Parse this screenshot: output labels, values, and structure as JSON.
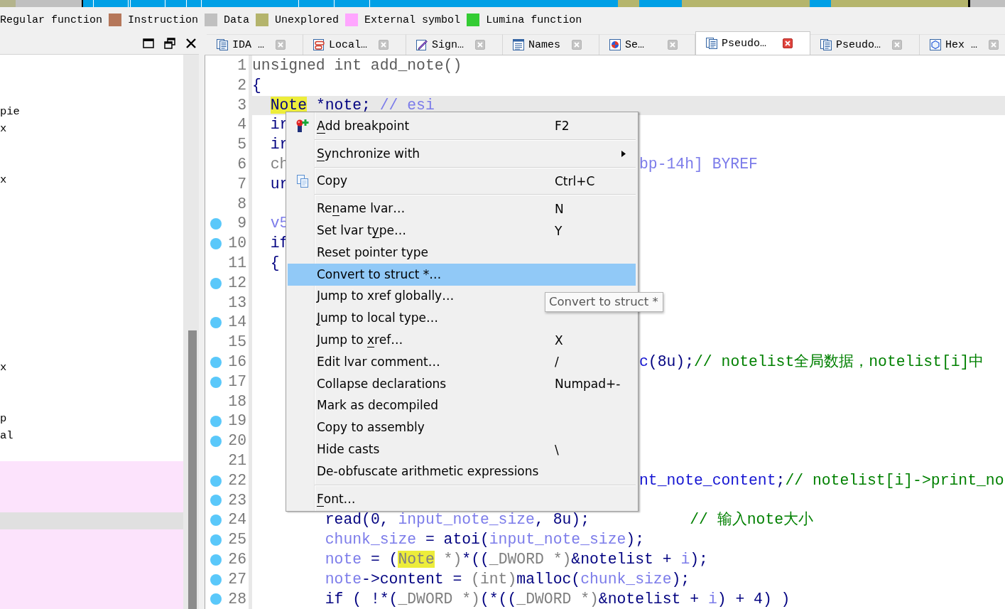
{
  "legend": [
    {
      "label": "Regular function"
    },
    {
      "label": "Instruction",
      "color": "#b5775a"
    },
    {
      "label": "Data",
      "color": "#c0c0c0"
    },
    {
      "label": "Unexplored",
      "color": "#b4b46c"
    },
    {
      "label": "External symbol",
      "color": "#ffa6ff"
    },
    {
      "label": "Lumina function",
      "color": "#33cc33"
    }
  ],
  "left_panel": {
    "rows": [
      {
        "kind": "function",
        "selected": false
      },
      {
        "kind": "function",
        "selected": false
      },
      {
        "kind": "function",
        "selected": false,
        "text": "pie"
      },
      {
        "kind": "function",
        "selected": false,
        "text": "x"
      },
      {
        "kind": "function",
        "selected": false
      },
      {
        "kind": "function",
        "selected": false
      },
      {
        "kind": "function",
        "selected": false,
        "text": "x"
      },
      {
        "kind": "function",
        "selected": false
      },
      {
        "kind": "function",
        "selected": false
      },
      {
        "kind": "function",
        "selected": false
      },
      {
        "kind": "function",
        "selected": false
      },
      {
        "kind": "function",
        "selected": false
      },
      {
        "kind": "function",
        "selected": false
      },
      {
        "kind": "function",
        "selected": false
      },
      {
        "kind": "function",
        "selected": false
      },
      {
        "kind": "function",
        "selected": false
      },
      {
        "kind": "function",
        "selected": false
      },
      {
        "kind": "function",
        "selected": false,
        "text": "x"
      },
      {
        "kind": "function",
        "selected": false
      },
      {
        "kind": "function",
        "selected": false
      },
      {
        "kind": "function",
        "selected": false,
        "text": "p"
      },
      {
        "kind": "function",
        "selected": false,
        "text": "al"
      },
      {
        "kind": "function",
        "selected": false
      },
      {
        "kind": "external",
        "selected": false
      },
      {
        "kind": "external",
        "selected": false
      },
      {
        "kind": "external",
        "selected": false
      },
      {
        "kind": "external",
        "selected": true
      },
      {
        "kind": "external",
        "selected": false
      },
      {
        "kind": "external",
        "selected": false
      },
      {
        "kind": "external",
        "selected": false
      },
      {
        "kind": "external",
        "selected": false
      },
      {
        "kind": "external",
        "selected": false
      }
    ]
  },
  "tabs": [
    {
      "label": "IDA …",
      "selected": false
    },
    {
      "label": "Local…",
      "selected": false
    },
    {
      "label": "Sign…",
      "selected": false
    },
    {
      "label": "Names",
      "selected": false
    },
    {
      "label": "Se…",
      "selected": false
    },
    {
      "label": "Pseudo…",
      "selected": true
    },
    {
      "label": "Pseudo…",
      "selected": false
    },
    {
      "label": "Hex …",
      "selected": false
    }
  ],
  "code": {
    "lines": [
      {
        "number": "1",
        "marker": false,
        "current": false,
        "code": [
          {
            "text": "unsigned int add_note()",
            "kind": "decl"
          }
        ]
      },
      {
        "number": "2",
        "marker": false,
        "current": false,
        "code": [
          {
            "text": "{",
            "kind": "kw"
          }
        ]
      },
      {
        "number": "3",
        "marker": false,
        "current": true,
        "code": [
          {
            "text": "  Note",
            "kind": "match"
          },
          {
            "text": " *note; ",
            "kind": "kw"
          },
          {
            "text": "// esi",
            "kind": "var"
          }
        ]
      },
      {
        "number": "4",
        "marker": false,
        "current": false,
        "code": [
          {
            "text": "  ir",
            "kind": "kw"
          }
        ]
      },
      {
        "number": "5",
        "marker": false,
        "current": false,
        "code": [
          {
            "text": "  ir",
            "kind": "kw"
          }
        ]
      },
      {
        "number": "6",
        "marker": false,
        "current": false,
        "code": [
          {
            "text": "  ch",
            "kind": "cast"
          }
        ],
        "after_menu": [
          {
            "text": "bp-14h] BYREF",
            "kind": "var"
          }
        ]
      },
      {
        "number": "7",
        "marker": false,
        "current": false,
        "code": [
          {
            "text": "  ur",
            "kind": "kw"
          }
        ]
      },
      {
        "number": "8",
        "marker": false,
        "current": false
      },
      {
        "number": "9",
        "marker": true,
        "current": false,
        "code": [
          {
            "text": "  v5",
            "kind": "var"
          }
        ]
      },
      {
        "number": "10",
        "marker": true,
        "current": false,
        "code": [
          {
            "text": "  if",
            "kind": "kw"
          }
        ]
      },
      {
        "number": "11",
        "marker": false,
        "current": false,
        "code": [
          {
            "text": "  {",
            "kind": "kw"
          }
        ]
      },
      {
        "number": "12",
        "marker": true,
        "current": false
      },
      {
        "number": "13",
        "marker": false,
        "current": false
      },
      {
        "number": "14",
        "marker": true,
        "current": false
      },
      {
        "number": "15",
        "marker": false,
        "current": false
      },
      {
        "number": "16",
        "marker": true,
        "current": false,
        "after_menu": [
          {
            "text": "c",
            "kind": "name"
          },
          {
            "text": "(8u);",
            "kind": "kw"
          },
          {
            "text": "// notelist全局数据，notelist[i]中",
            "kind": "comment"
          }
        ]
      },
      {
        "number": "17",
        "marker": true,
        "current": false
      },
      {
        "number": "18",
        "marker": false,
        "current": false
      },
      {
        "number": "19",
        "marker": true,
        "current": false
      },
      {
        "number": "20",
        "marker": true,
        "current": false
      },
      {
        "number": "21",
        "marker": false,
        "current": false
      },
      {
        "number": "22",
        "marker": true,
        "current": false,
        "after_menu": [
          {
            "text": "nt_note_content",
            "kind": "name"
          },
          {
            "text": ";",
            "kind": "kw"
          },
          {
            "text": "// notelist[i]->print_no",
            "kind": "comment"
          }
        ]
      },
      {
        "number": "23",
        "marker": true,
        "current": false
      },
      {
        "number": "24",
        "marker": true,
        "current": false,
        "code": [
          {
            "text": "        read(0, ",
            "kind": "kw"
          },
          {
            "text": "input_note_size",
            "kind": "var"
          },
          {
            "text": ", 8u);",
            "kind": "kw"
          },
          {
            "text": "           // 输入note大小",
            "kind": "comment"
          }
        ]
      },
      {
        "number": "25",
        "marker": true,
        "current": false,
        "code": [
          {
            "text": "        chunk_size",
            "kind": "var"
          },
          {
            "text": " = atoi(",
            "kind": "kw"
          },
          {
            "text": "input_note_size",
            "kind": "var"
          },
          {
            "text": ");",
            "kind": "kw"
          }
        ]
      },
      {
        "number": "26",
        "marker": true,
        "current": false,
        "code": [
          {
            "text": "        note",
            "kind": "var"
          },
          {
            "text": " = (",
            "kind": "kw"
          },
          {
            "text": "Note",
            "kind": "match-cast"
          },
          {
            "text": " *)",
            "kind": "cast"
          },
          {
            "text": "*((",
            "kind": "kw"
          },
          {
            "text": "_DWORD *)",
            "kind": "cast"
          },
          {
            "text": "&notelist + ",
            "kind": "kw"
          },
          {
            "text": "i",
            "kind": "var"
          },
          {
            "text": ");",
            "kind": "kw"
          }
        ]
      },
      {
        "number": "27",
        "marker": true,
        "current": false,
        "code": [
          {
            "text": "        note",
            "kind": "var"
          },
          {
            "text": "->content = ",
            "kind": "kw"
          },
          {
            "text": "(int)",
            "kind": "cast"
          },
          {
            "text": "malloc(",
            "kind": "kw"
          },
          {
            "text": "chunk_size",
            "kind": "var"
          },
          {
            "text": ");",
            "kind": "kw"
          }
        ]
      },
      {
        "number": "28",
        "marker": true,
        "current": false,
        "code": [
          {
            "text": "        if ( !*(",
            "kind": "kw"
          },
          {
            "text": "_DWORD *)",
            "kind": "cast"
          },
          {
            "text": "(*((",
            "kind": "kw"
          },
          {
            "text": "_DWORD *)",
            "kind": "cast"
          },
          {
            "text": "&notelist + ",
            "kind": "kw"
          },
          {
            "text": "i",
            "kind": "var"
          },
          {
            "text": ") + 4) )",
            "kind": "kw"
          }
        ]
      }
    ]
  },
  "context_menu": {
    "entries": [
      {
        "kind": "item",
        "parts": [
          {
            "text": "A",
            "underlined": true
          },
          {
            "text": "dd breakpoint",
            "underlined": false
          }
        ],
        "shortcut": "F2",
        "submenu": false,
        "selected": false
      },
      {
        "kind": "separator"
      },
      {
        "kind": "item",
        "parts": [
          {
            "text": "S",
            "underlined": true
          },
          {
            "text": "ynchronize with",
            "underlined": false
          }
        ],
        "submenu": true,
        "selected": false
      },
      {
        "kind": "separator"
      },
      {
        "kind": "item",
        "parts": [
          {
            "text": "Copy",
            "underlined": false
          }
        ],
        "shortcut": "Ctrl+C",
        "submenu": false,
        "selected": false
      },
      {
        "kind": "separator"
      },
      {
        "kind": "item",
        "parts": [
          {
            "text": "Re",
            "underlined": false
          },
          {
            "text": "n",
            "underlined": true
          },
          {
            "text": "ame lvar…",
            "underlined": false
          }
        ],
        "shortcut": "N",
        "submenu": false,
        "selected": false
      },
      {
        "kind": "item",
        "parts": [
          {
            "text": "Set lvar t",
            "underlined": false
          },
          {
            "text": "y",
            "underlined": true
          },
          {
            "text": "pe…",
            "underlined": false
          }
        ],
        "shortcut": "Y",
        "submenu": false,
        "selected": false
      },
      {
        "kind": "item",
        "parts": [
          {
            "text": "Reset pointer type",
            "underlined": false
          }
        ],
        "submenu": false,
        "selected": false
      },
      {
        "kind": "item",
        "parts": [
          {
            "text": "Convert to struct *…",
            "underlined": false
          }
        ],
        "submenu": false,
        "selected": true
      },
      {
        "kind": "item",
        "parts": [
          {
            "text": "Jump to xref globally…",
            "underlined": false
          }
        ],
        "submenu": false,
        "selected": false
      },
      {
        "kind": "item",
        "parts": [
          {
            "text": "J",
            "underlined": true
          },
          {
            "text": "ump to local type…",
            "underlined": false
          }
        ],
        "submenu": false,
        "selected": false
      },
      {
        "kind": "item",
        "parts": [
          {
            "text": "Jump to ",
            "underlined": false
          },
          {
            "text": "x",
            "underlined": true
          },
          {
            "text": "ref…",
            "underlined": false
          }
        ],
        "shortcut": "X",
        "submenu": false,
        "selected": false
      },
      {
        "kind": "item",
        "parts": [
          {
            "text": "Edit lvar comment…",
            "underlined": false
          }
        ],
        "shortcut": "/",
        "submenu": false,
        "selected": false
      },
      {
        "kind": "item",
        "parts": [
          {
            "text": "Collapse declarations",
            "underlined": false
          }
        ],
        "shortcut": "Numpad+-",
        "submenu": false,
        "selected": false
      },
      {
        "kind": "item",
        "parts": [
          {
            "text": "Mark as decompiled",
            "underlined": false
          }
        ],
        "submenu": false,
        "selected": false
      },
      {
        "kind": "item",
        "parts": [
          {
            "text": "Copy to assembly",
            "underlined": false
          }
        ],
        "submenu": false,
        "selected": false
      },
      {
        "kind": "item",
        "parts": [
          {
            "text": "Hide casts",
            "underlined": false
          }
        ],
        "shortcut": "\\",
        "submenu": false,
        "selected": false
      },
      {
        "kind": "item",
        "parts": [
          {
            "text": "De-obfuscate arithmetic expressions",
            "underlined": false
          }
        ],
        "submenu": false,
        "selected": false
      },
      {
        "kind": "separator"
      },
      {
        "kind": "item",
        "parts": [
          {
            "text": "F",
            "underlined": true
          },
          {
            "text": "ont…",
            "underlined": false
          }
        ],
        "submenu": false,
        "selected": false
      }
    ]
  },
  "tooltip": {
    "text": "Convert to struct *"
  }
}
